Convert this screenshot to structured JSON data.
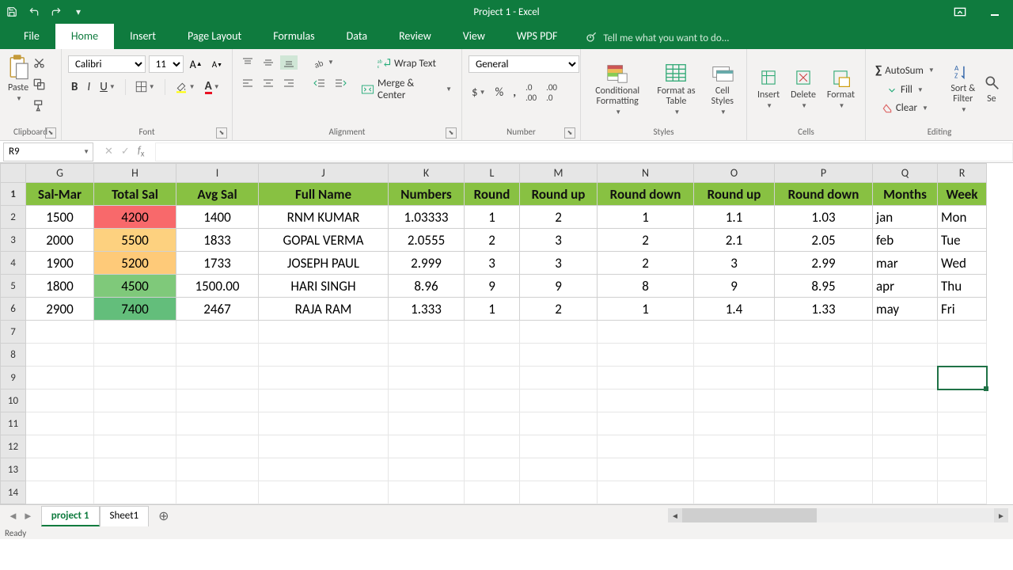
{
  "title": "Project 1 - Excel",
  "qat": {
    "save": "💾"
  },
  "tabs": [
    "File",
    "Home",
    "Insert",
    "Page Layout",
    "Formulas",
    "Data",
    "Review",
    "View",
    "WPS PDF"
  ],
  "active_tab": 1,
  "tellme": "Tell me what you want to do...",
  "ribbon": {
    "clipboard": {
      "paste": "Paste",
      "name": "Clipboard"
    },
    "font": {
      "name_box": "Calibri",
      "size": "11",
      "name": "Font"
    },
    "alignment": {
      "wrap": "Wrap Text",
      "merge": "Merge & Center",
      "name": "Alignment"
    },
    "number": {
      "format": "General",
      "name": "Number"
    },
    "styles": {
      "cond": "Conditional Formatting",
      "fmtas": "Format as Table",
      "cell": "Cell Styles",
      "name": "Styles"
    },
    "cells": {
      "insert": "Insert",
      "delete": "Delete",
      "format": "Format",
      "name": "Cells"
    },
    "editing": {
      "autosum": "AutoSum",
      "fill": "Fill",
      "clear": "Clear",
      "sort": "Sort & Filter",
      "find": "Se",
      "name": "Editing"
    }
  },
  "namebox": "R9",
  "columns": [
    "G",
    "H",
    "I",
    "J",
    "K",
    "L",
    "M",
    "N",
    "O",
    "P",
    "Q",
    "R"
  ],
  "col_widths": [
    "colG",
    "colH",
    "colI",
    "colJ",
    "colK",
    "colL",
    "colM",
    "colN",
    "colO",
    "colP",
    "colQ",
    "colR"
  ],
  "headers": [
    "Sal-Mar",
    "Total Sal",
    "Avg Sal",
    "Full Name",
    "Numbers",
    "Round",
    "Round up",
    "Round down",
    "Round up",
    "Round down",
    "Months",
    "Week"
  ],
  "rows": [
    {
      "n": "2",
      "g": "1500",
      "h": "4200",
      "hc": "h-red",
      "i": "1400",
      "j": "RNM  KUMAR",
      "k": "1.03333",
      "l": "1",
      "m": "2",
      "nn": "1",
      "o": "1.1",
      "p": "1.03",
      "q": "jan",
      "r": "Mon"
    },
    {
      "n": "3",
      "g": "2000",
      "h": "5500",
      "hc": "h-yel1",
      "i": "1833",
      "j": "GOPAL  VERMA",
      "k": "2.0555",
      "l": "2",
      "m": "3",
      "nn": "2",
      "o": "2.1",
      "p": "2.05",
      "q": "feb",
      "r": "Tue"
    },
    {
      "n": "4",
      "g": "1900",
      "h": "5200",
      "hc": "h-yel2",
      "i": "1733",
      "j": "JOSEPH  PAUL",
      "k": "2.999",
      "l": "3",
      "m": "3",
      "nn": "2",
      "o": "3",
      "p": "2.99",
      "q": "mar",
      "r": "Wed"
    },
    {
      "n": "5",
      "g": "1800",
      "h": "4500",
      "hc": "h-grn1",
      "i": "1500.00",
      "j": "HARI  SINGH",
      "k": "8.96",
      "l": "9",
      "m": "9",
      "nn": "8",
      "o": "9",
      "p": "8.95",
      "q": "apr",
      "r": "Thu"
    },
    {
      "n": "6",
      "g": "2900",
      "h": "7400",
      "hc": "h-grn2",
      "i": "2467",
      "j": "RAJA  RAM",
      "k": "1.333",
      "l": "1",
      "m": "2",
      "nn": "1",
      "o": "1.4",
      "p": "1.33",
      "q": "may",
      "r": "Fri"
    }
  ],
  "empty_rows": [
    "7",
    "8",
    "9",
    "10",
    "11",
    "12",
    "13",
    "14"
  ],
  "selected_cell_row": "9",
  "sheets": [
    "project 1",
    "Sheet1"
  ],
  "active_sheet": 0,
  "status": "Ready"
}
